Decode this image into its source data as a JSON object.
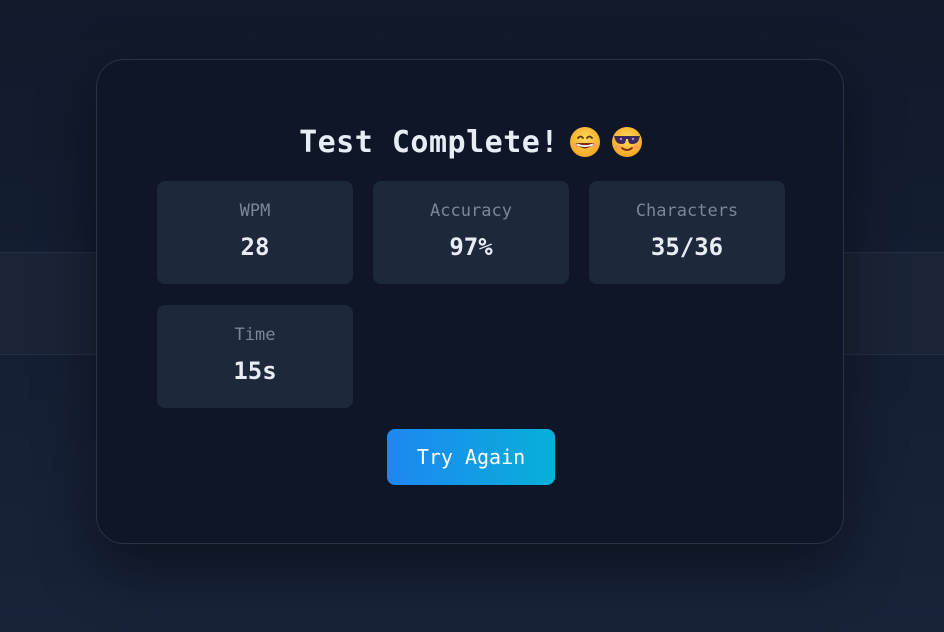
{
  "result": {
    "title": "Test Complete!",
    "emojis": [
      "grinning-face-icon",
      "smiling-face-with-sunglasses-icon"
    ],
    "stats": [
      {
        "label": "WPM",
        "value": "28"
      },
      {
        "label": "Accuracy",
        "value": "97%"
      },
      {
        "label": "Characters",
        "value": "35/36"
      },
      {
        "label": "Time",
        "value": "15s"
      }
    ],
    "retry_label": "Try Again"
  },
  "colors": {
    "card_background": "#0e1628",
    "stat_background": "#1d283b",
    "button_gradient_start": "#1f86f2",
    "button_gradient_end": "#07b0d8"
  }
}
